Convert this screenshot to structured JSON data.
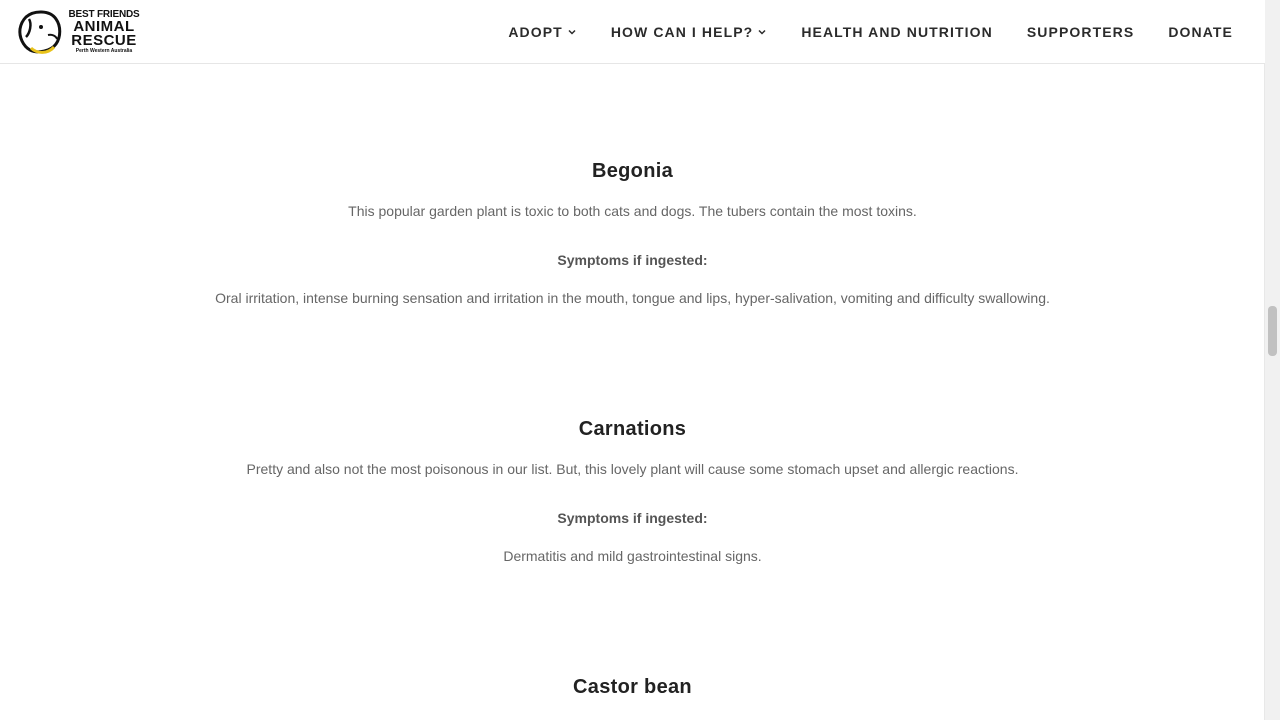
{
  "header": {
    "logo": {
      "line1": "BEST FRIENDS",
      "line2": "ANIMAL",
      "line3": "RESCUE",
      "line4": "Perth Western Australia"
    },
    "nav": [
      {
        "label": "ADOPT",
        "has_dropdown": true
      },
      {
        "label": "HOW CAN I HELP?",
        "has_dropdown": true
      },
      {
        "label": "HEALTH AND NUTRITION",
        "has_dropdown": false
      },
      {
        "label": "SUPPORTERS",
        "has_dropdown": false
      },
      {
        "label": "DONATE",
        "has_dropdown": false
      }
    ]
  },
  "sections": [
    {
      "title": "Begonia",
      "description": "This popular garden plant is toxic to both cats and dogs. The tubers contain the most toxins.",
      "symptoms_label": "Symptoms if ingested:",
      "symptoms": "Oral irritation, intense burning sensation and irritation in the mouth, tongue and lips, hyper-salivation, vomiting and difficulty swallowing."
    },
    {
      "title": "Carnations",
      "description": "Pretty and also not the most poisonous in our list. But, this lovely plant will cause some stomach upset and allergic reactions.",
      "symptoms_label": "Symptoms if ingested:",
      "symptoms": "Dermatitis and mild gastrointestinal signs."
    },
    {
      "title": "Castor bean"
    }
  ],
  "colors": {
    "heading": "#222222",
    "body_text": "#666666",
    "nav_text": "#2b2b2b",
    "logo_accent": "#e8c21a"
  }
}
